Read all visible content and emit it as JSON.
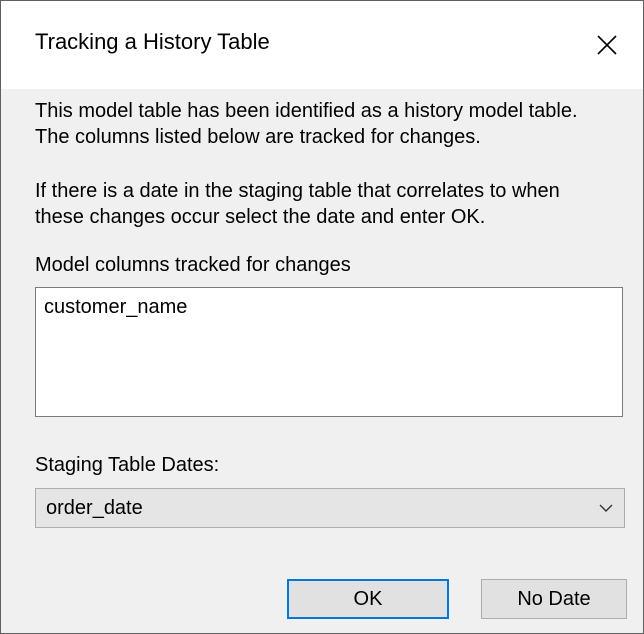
{
  "window": {
    "title": "Tracking a History Table"
  },
  "content": {
    "intro_line1": "This model table has been identified as a history model table.",
    "intro_line2": "The columns listed below are tracked for changes.",
    "date_line1": "If there is a date in the staging table that correlates to when",
    "date_line2": "these changes occur select the date and enter OK.",
    "columns_label": "Model columns tracked for changes",
    "tracked_columns": [
      "customer_name"
    ],
    "staging_dates_label": "Staging Table Dates:",
    "staging_date_selected": "order_date"
  },
  "buttons": {
    "ok_label": "OK",
    "nodate_label": "No Date"
  },
  "icons": {
    "close": "close-icon",
    "dropdown": "chevron-down-icon"
  },
  "colors": {
    "accent": "#0078d7",
    "dialog_bg": "#f0f0f0",
    "titlebar_bg": "#ffffff"
  }
}
